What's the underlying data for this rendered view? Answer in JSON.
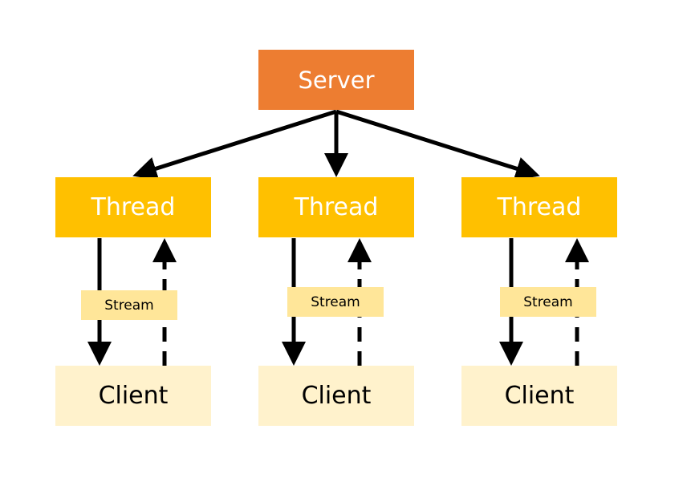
{
  "diagram": {
    "server": {
      "label": "Server",
      "color": "#ED7D31"
    },
    "threads": [
      {
        "label": "Thread",
        "color": "#FFC000"
      },
      {
        "label": "Thread",
        "color": "#FFC000"
      },
      {
        "label": "Thread",
        "color": "#FFC000"
      }
    ],
    "streams": [
      {
        "label": "Stream",
        "color": "#FFE699"
      },
      {
        "label": "Stream",
        "color": "#FFE699"
      },
      {
        "label": "Stream",
        "color": "#FFE699"
      }
    ],
    "clients": [
      {
        "label": "Client",
        "color": "#FFF2CC"
      },
      {
        "label": "Client",
        "color": "#FFF2CC"
      },
      {
        "label": "Client",
        "color": "#FFF2CC"
      }
    ],
    "edges": [
      {
        "from": "server",
        "to": "thread-1",
        "style": "solid"
      },
      {
        "from": "server",
        "to": "thread-2",
        "style": "solid"
      },
      {
        "from": "server",
        "to": "thread-3",
        "style": "solid"
      },
      {
        "from": "thread-1",
        "to": "client-1",
        "style": "solid",
        "via": "stream-1"
      },
      {
        "from": "client-1",
        "to": "thread-1",
        "style": "dashed"
      },
      {
        "from": "thread-2",
        "to": "client-2",
        "style": "solid",
        "via": "stream-2"
      },
      {
        "from": "client-2",
        "to": "thread-2",
        "style": "dashed"
      },
      {
        "from": "thread-3",
        "to": "client-3",
        "style": "solid",
        "via": "stream-3"
      },
      {
        "from": "client-3",
        "to": "thread-3",
        "style": "dashed"
      }
    ]
  }
}
